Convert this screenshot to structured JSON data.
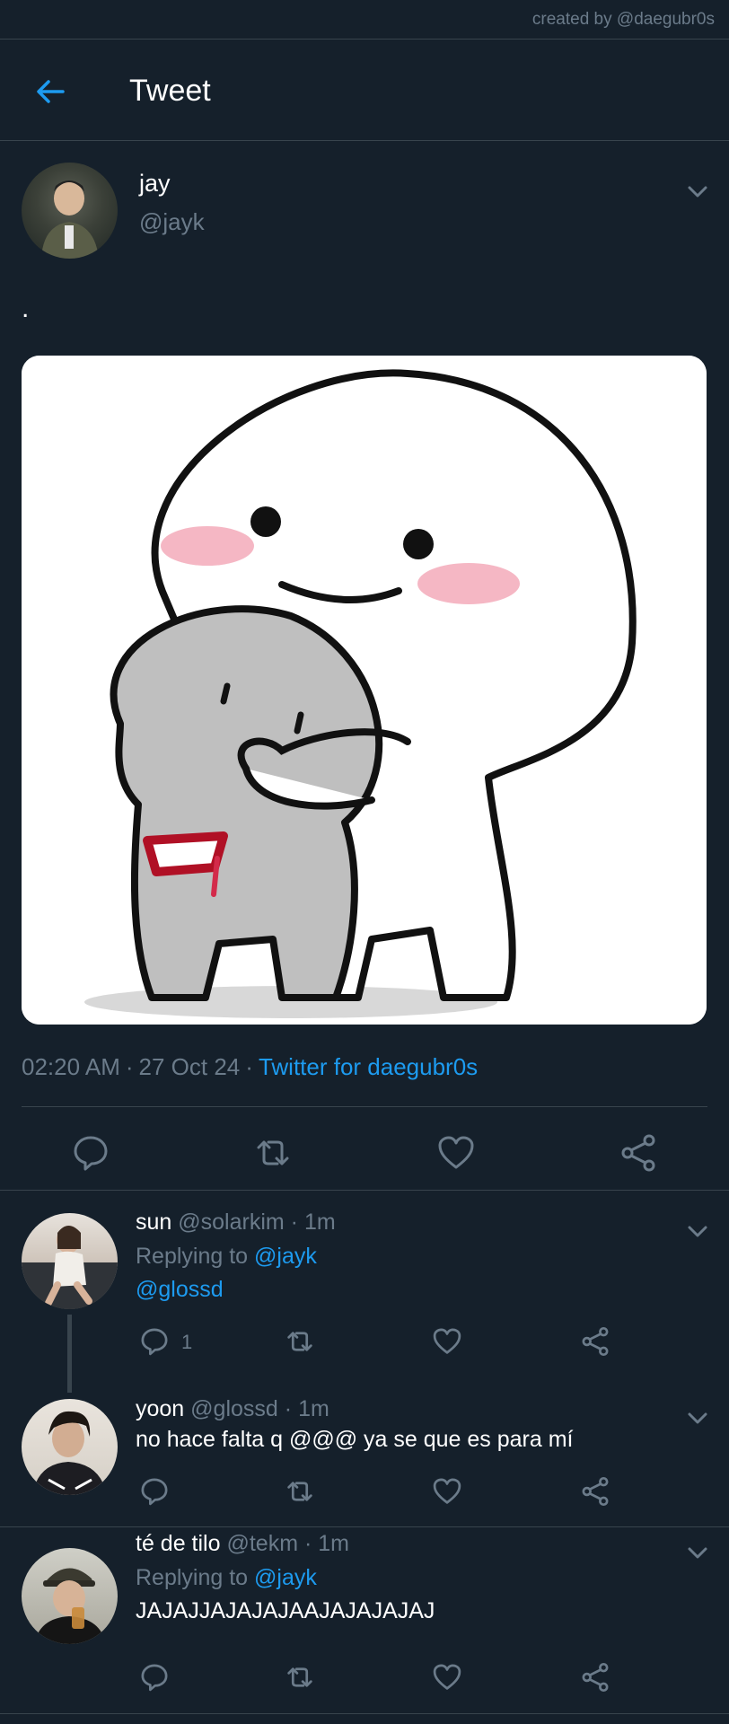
{
  "credit": "created by @daegubr0s",
  "header": {
    "title": "Tweet"
  },
  "tweet": {
    "name": "jay",
    "handle": "@jayk",
    "text": ".",
    "time": "02:20 AM",
    "date": "27 Oct 24",
    "source": "Twitter for daegubr0s",
    "sep": "·"
  },
  "replies": [
    {
      "name": "sun",
      "handle": "@solarkim",
      "dot": "·",
      "time": "1m",
      "replying_prefix": "Replying to",
      "replying_to": "@jayk",
      "text": "@glossd",
      "reply_count": "1"
    },
    {
      "name": "yoon",
      "handle": "@glossd",
      "dot": "·",
      "time": "1m",
      "text": "no hace falta q @@@ ya se que es para mí"
    },
    {
      "name": "té de tilo",
      "handle": "@tekm",
      "dot": "·",
      "time": "1m",
      "replying_prefix": "Replying to",
      "replying_to": "@jayk",
      "text": "JAJAJJAJAJAJAAJAJAJAJAJ"
    }
  ],
  "colors": {
    "background": "#15202b",
    "accent": "#1d9bf0",
    "muted": "#6b7b8a",
    "divider": "#38444d"
  }
}
